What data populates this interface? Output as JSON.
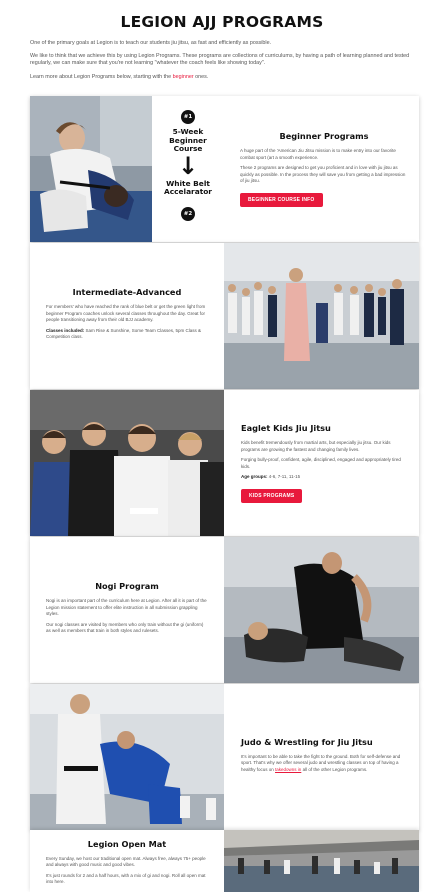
{
  "page": {
    "title": "LEGION AJJ PROGRAMS"
  },
  "intro": {
    "p1": "One of the primary goals at Legion is to teach our students jiu jitsu, as fast and efficiently as possible.",
    "p2": "We like to think that we achieve this by using Legion Programs. These programs are collections of curriculums, by having a path of learning planned and tested regularly, we can make sure that you're not learning \"whatever the coach feels like showing today\".",
    "p3_pre": "Learn more about Legion Programs below, starting with the ",
    "p3_link": "beginner",
    "p3_post": " ones."
  },
  "programs": {
    "beginner": {
      "promo_num1": "#1",
      "promo_line1": "5-Week",
      "promo_line2": "Beginner",
      "promo_line3": "Course",
      "promo_line4": "White Belt",
      "promo_line5": "Accelarator",
      "promo_num2": "#2",
      "title": "Beginner Programs",
      "p1": "A huge part of the 'American Jiu Jitsu mission is to make entry into our favorite combat sport (art a smooth experience.",
      "p2": "These 2 programs are designed to get you proficient and in love with jiu jitsu as quickly as possible. In the process they will save you from getting a bad impression of jiu jitsu.",
      "button": "BEGINNER COURSE INFO"
    },
    "intermediate": {
      "title": "Intermediate-Advanced",
      "p1": "For members' who have reached the rank of blue belt or get the green light from beginner Program coaches unlock several classes throughout the day. Great for people transitioning away from their old BJJ academy.",
      "label": "Classes included:",
      "p2": " Sam Rise & Sunshine, Some Team Classes, 5pm Class & Competition class."
    },
    "kids": {
      "title": "Eaglet Kids Jiu Jitsu",
      "p1": "Kids benefit tremendously from martial arts, but especially jiu jitsu. Our kids programs are growing the fastest and changing family lives.",
      "p2": "Forging bully-proof, confident, agile, disciplined, engaged and appropriately tired kids.",
      "label": "Age groups:",
      "ages": " 4-6, 7-11, 11-15",
      "button": "KIDS PROGRAMS"
    },
    "nogi": {
      "title": "Nogi Program",
      "p1": "Nogi is an important part of the curriculum here at Legion. After all it is part of the Legion mission statement to offer elite instruction in all submission grappling styles.",
      "p2": "Our nogi classes are visited by members who only train without the gi (uniform) as well as members that train in both styles and rulesets."
    },
    "judo": {
      "title": "Judo & Wrestling for Jiu Jitsu",
      "p1_pre": "It's important to be able to take the fight to the ground. Both for self-defense and sport. That's why we offer several judo and wrestling classes on top of having a healthy focus on ",
      "p1_link": "takedowns in",
      "p1_post": " all of the other Legion programs."
    },
    "openmat": {
      "title": "Legion Open Mat",
      "p1": "Every Sunday, we host our traditional open mat. Always free, always 75+ people and always with good music and good vibes.",
      "p2": "It's just rounds for 2 and a half hours, with a mix of gi and nogi. Roll all open mat into here."
    }
  },
  "colors": {
    "accent": "#e8193c",
    "heading": "#111111",
    "body_text": "#555555"
  }
}
